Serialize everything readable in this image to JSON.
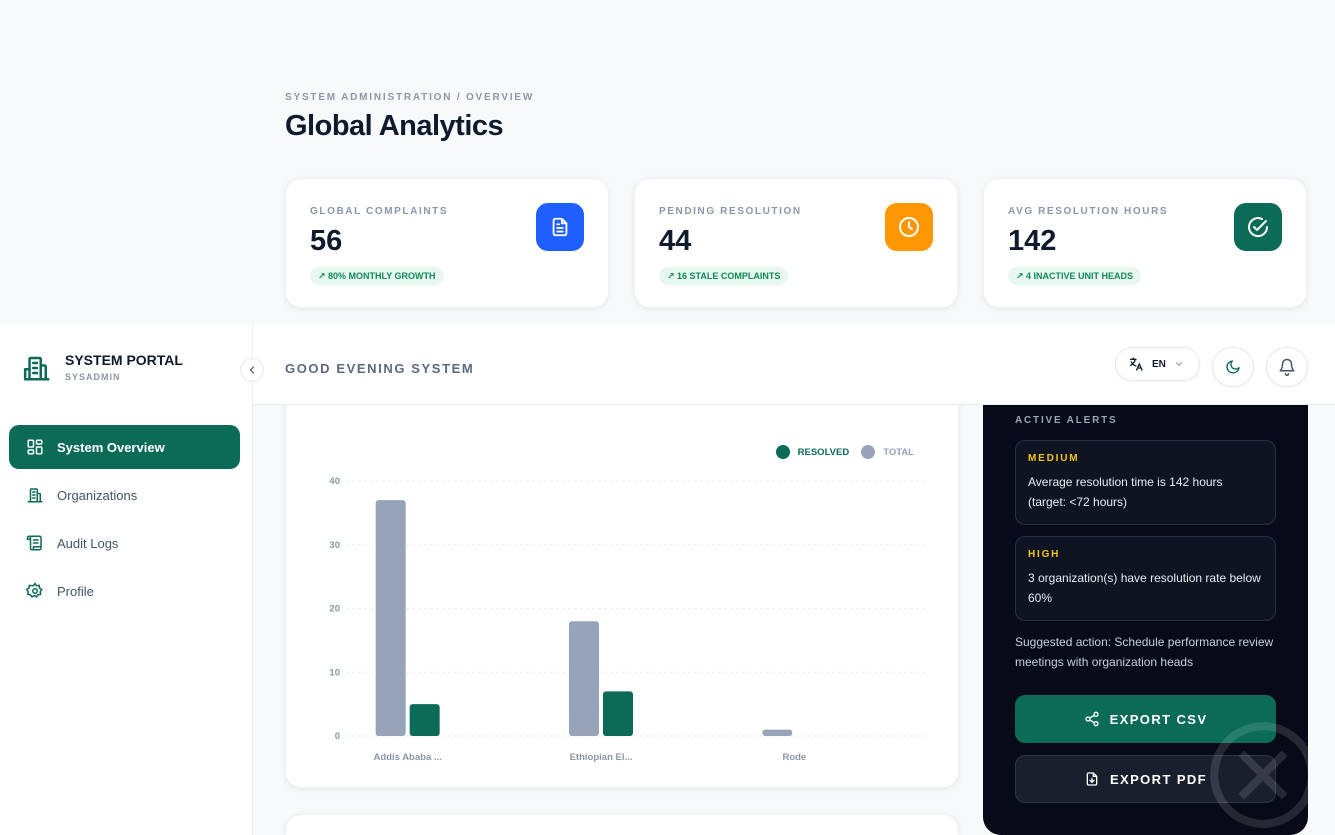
{
  "header": {
    "breadcrumb": "SYSTEM ADMINISTRATION / OVERVIEW",
    "title": "Global Analytics"
  },
  "stats": [
    {
      "label": "GLOBAL COMPLAINTS",
      "value": "56",
      "badge": "↗ 80% MONTHLY GROWTH",
      "icon": "document-icon",
      "color": "#1f5eff"
    },
    {
      "label": "PENDING RESOLUTION",
      "value": "44",
      "badge": "↗ 16 STALE COMPLAINTS",
      "icon": "clock-icon",
      "color": "#ff9800"
    },
    {
      "label": "AVG RESOLUTION HOURS",
      "value": "142",
      "badge": "↗ 4 INACTIVE UNIT HEADS",
      "icon": "check-circle-icon",
      "color": "#0b6b57"
    }
  ],
  "sidebar": {
    "brand_title": "SYSTEM PORTAL",
    "brand_sub": "SYSADMIN",
    "items": [
      {
        "label": "System Overview",
        "icon": "grid-icon",
        "active": true
      },
      {
        "label": "Organizations",
        "icon": "building-icon",
        "active": false
      },
      {
        "label": "Audit Logs",
        "icon": "scroll-icon",
        "active": false
      },
      {
        "label": "Profile",
        "icon": "gear-icon",
        "active": false
      }
    ]
  },
  "topbar": {
    "greeting": "GOOD EVENING SYSTEM",
    "language": "EN"
  },
  "chart_data": {
    "type": "bar",
    "categories": [
      "Addis Ababa ...",
      "Ethiopian El...",
      "Rode"
    ],
    "series": [
      {
        "name": "TOTAL",
        "values": [
          37,
          18,
          1
        ],
        "color": "#97a3b8"
      },
      {
        "name": "RESOLVED",
        "values": [
          5,
          7,
          0
        ],
        "color": "#0b6b57"
      }
    ],
    "ylim": [
      0,
      40
    ],
    "yticks": [
      0,
      10,
      20,
      30,
      40
    ],
    "grid": true,
    "legend": "top-right"
  },
  "alerts": {
    "title": "ACTIVE ALERTS",
    "items": [
      {
        "severity": "MEDIUM",
        "message": "Average resolution time is 142 hours (target: <72 hours)"
      },
      {
        "severity": "HIGH",
        "message": "3 organization(s) have resolution rate below 60%"
      }
    ],
    "suggestion": "Suggested action: Schedule performance review meetings with organization heads",
    "export_csv": "EXPORT CSV",
    "export_pdf": "EXPORT PDF"
  }
}
